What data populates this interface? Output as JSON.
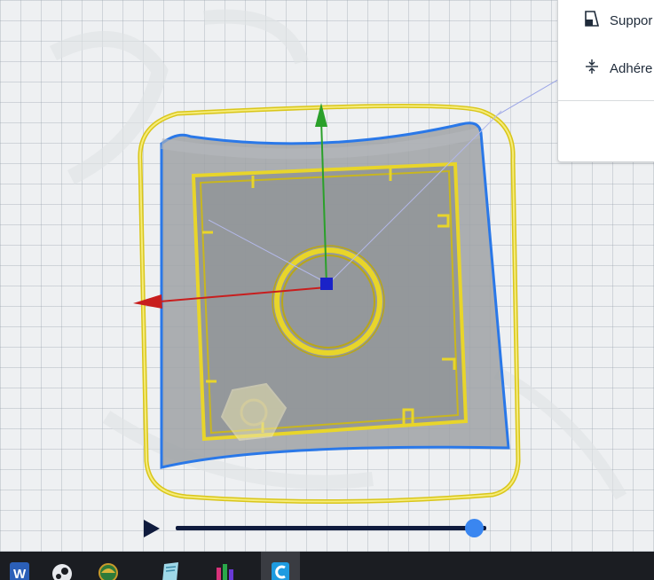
{
  "settings_panel": {
    "support_label": "Suppor",
    "adhesion_label": "Adhére"
  },
  "layer_view": {
    "progress": 0.96
  },
  "taskbar": {
    "apps": [
      {
        "name": "word-icon",
        "active": false
      },
      {
        "name": "steam-icon",
        "active": false
      },
      {
        "name": "globe-app-icon",
        "active": false
      },
      {
        "name": "notepad-icon",
        "active": false
      },
      {
        "name": "chart-app-icon",
        "active": false
      },
      {
        "name": "cura-icon",
        "active": true
      }
    ]
  },
  "colors": {
    "outline_yellow": "#f0df2a",
    "shell_blue": "#2a78e8",
    "axis_x_red": "#c81e1e",
    "axis_y_green": "#2aa02a",
    "axis_origin_blue": "#1a22c8"
  }
}
